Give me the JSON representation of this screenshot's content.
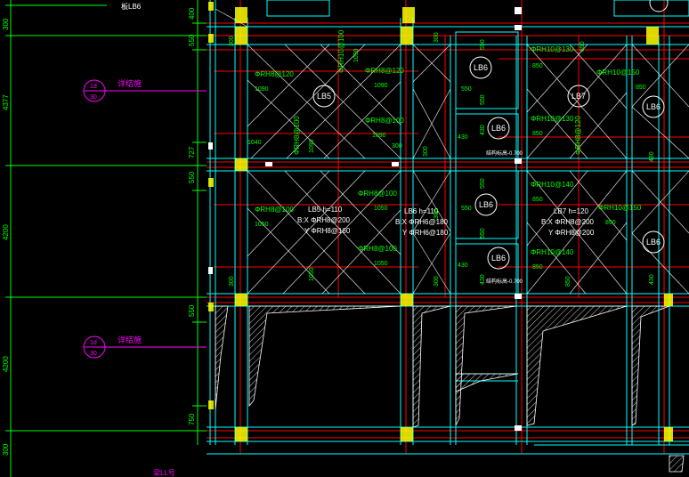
{
  "colors": {
    "background": "#000000",
    "dimension": "#00ff00",
    "axis": "#ff0000",
    "beam": "#00ffff",
    "slab_line": "#ffffff",
    "rebar_text": "#00ff00",
    "annotation": "#ff00ff",
    "column": "#ffff00",
    "hatch": "#ffffff",
    "label": "#ffffff"
  },
  "dimensions_left": [
    "300",
    "4377",
    "4200",
    "4200",
    "300"
  ],
  "dimensions_mid": [
    "400",
    "550",
    "727",
    "550",
    "550",
    "750"
  ],
  "detail_callouts": [
    {
      "top": "1d",
      "bottom": "30",
      "text": "详结施"
    },
    {
      "top": "1d",
      "bottom": "30",
      "text": "详结施"
    }
  ],
  "slab_labels": [
    "LB5",
    "LB6",
    "LB6",
    "LB7",
    "LB6",
    "LB6",
    "LB6",
    "LB6"
  ],
  "slab_specs": [
    {
      "l1": "LB5 h=110",
      "l2": "B:X ΦRH8@200",
      "l3": "Y ΦRH8@160"
    },
    {
      "l1": "LB6 h=110",
      "l2": "B:X ΦRH6@180",
      "l3": "Y ΦRH6@180"
    },
    {
      "l1": "LB7 h=120",
      "l2": "B:X ΦRH8@200",
      "l3": "Y ΦRH8@200"
    }
  ],
  "rebar_notes": {
    "r1": "ΦRH10@100",
    "r2": "ΦRH8@120",
    "r3": "ΦRH8@120",
    "r4": "ΦRH8@100",
    "r5": "ΦRH8@100",
    "r6": "ΦRH8@100",
    "r7": "ΦRH10@130",
    "r8": "ΦRH10@150",
    "r9": "ΦRH10@130",
    "r10": "ΦRH8@120",
    "r11": "ΦRH10@140",
    "r12": "ΦRH10@150",
    "r13": "ΦRH10@140"
  },
  "lengths": {
    "a1": "1090",
    "a2": "1090",
    "a3": "1090",
    "a4": "1090",
    "a5": "1050",
    "a6": "1050",
    "a7": "1050",
    "a8": "1040",
    "b1": "850",
    "b2": "850",
    "b3": "850",
    "b4": "850",
    "b5": "850",
    "c1": "550",
    "c2": "550",
    "c3": "550",
    "c4": "550",
    "d1": "430",
    "d2": "430",
    "d3": "430",
    "d4": "430",
    "e1": "300",
    "e2": "300",
    "e3": "300",
    "e4": "300",
    "e5": "300"
  },
  "elevations": [
    "结构标高-0.700",
    "结构标高-0.700"
  ],
  "top_labels": [
    "板LB6"
  ],
  "bottom_labels": [
    "梁LL号"
  ]
}
